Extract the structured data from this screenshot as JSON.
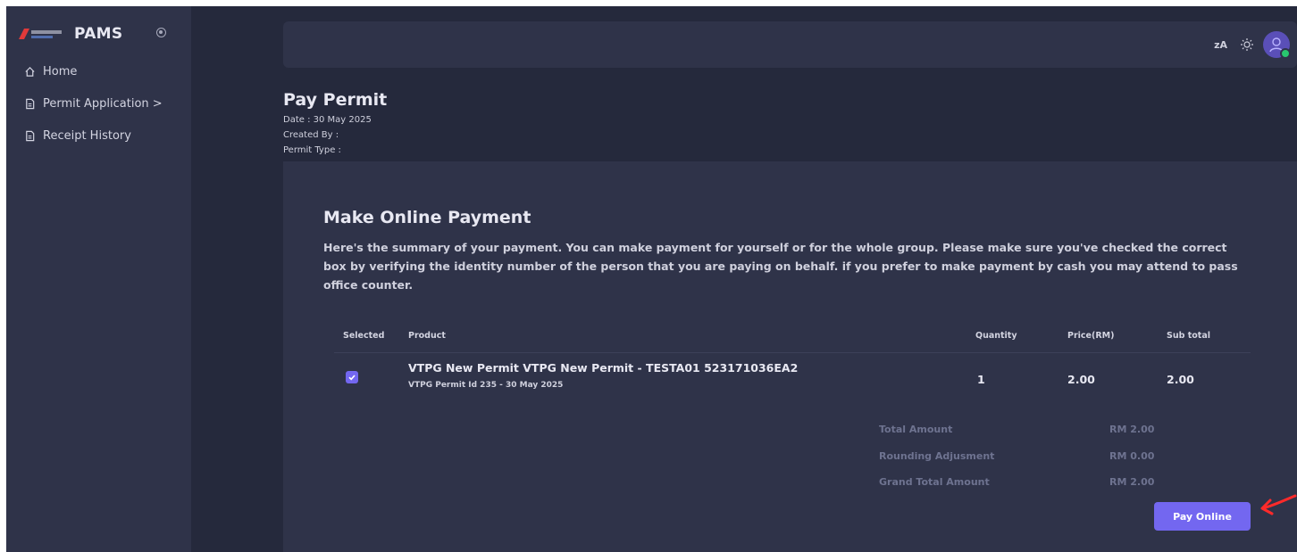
{
  "app": {
    "name": "PAMS"
  },
  "sidebar": {
    "items": [
      {
        "label": "Home",
        "icon": "home-icon"
      },
      {
        "label": "Permit Application >",
        "icon": "document-icon"
      },
      {
        "label": "Receipt History",
        "icon": "document-icon"
      }
    ]
  },
  "topbar": {
    "translate_label": "ᴢA",
    "icons": [
      "translate-icon",
      "sun-icon",
      "user-avatar-icon"
    ]
  },
  "page": {
    "title": "Pay Permit",
    "date": "Date : 30 May 2025",
    "created_by": "Created By :",
    "permit_type": "Permit Type :"
  },
  "payment": {
    "title": "Make Online Payment",
    "description": "Here's the summary of your payment. You can make payment for yourself or for the whole group. Please make sure you've checked the correct box by verifying the identity number of the person that you are paying on behalf. if you prefer to make payment by cash you may attend to pass office counter.",
    "table": {
      "headers": [
        "Selected",
        "Product",
        "Quantity",
        "Price(RM)",
        "Sub total"
      ],
      "rows": [
        {
          "selected": true,
          "product": "VTPG New Permit VTPG New Permit - TESTA01 523171036EA2",
          "product_sub": "VTPG Permit Id 235 - 30 May 2025",
          "quantity": "1",
          "price": "2.00",
          "subtotal": "2.00"
        }
      ]
    },
    "summary": {
      "total_label": "Total Amount",
      "total_value": "RM 2.00",
      "rounding_label": "Rounding Adjusment",
      "rounding_value": "RM 0.00",
      "grand_label": "Grand Total Amount",
      "grand_value": "RM 2.00"
    },
    "pay_button": "Pay Online"
  },
  "colors": {
    "background": "#25293c",
    "surface": "#2f3349",
    "accent": "#7367f0",
    "annotation_arrow": "#ff2a2a",
    "status_online": "#28c76f"
  }
}
